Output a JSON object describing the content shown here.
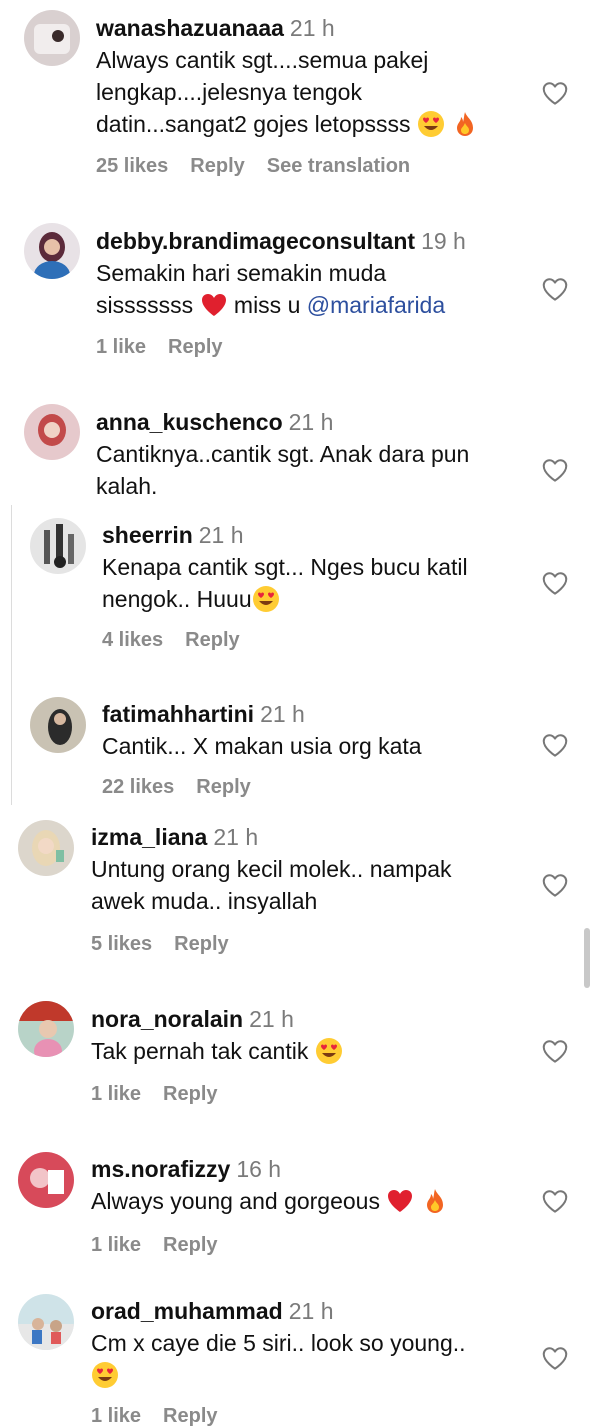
{
  "comments": [
    {
      "username": "wanashazuanaaa",
      "time": "21 h",
      "lines": [
        "Always cantik sgt....semua pakej",
        "lengkap....jelesnya tengok",
        "datin...sangat2 gojes letopssss"
      ],
      "line_emojis": [
        [],
        [],
        [
          "heart-eyes",
          "fire"
        ]
      ],
      "likes": "25 likes",
      "reply": "Reply",
      "translation": "See translation"
    },
    {
      "username": "debby.brandimageconsultant",
      "time": "19 h",
      "lines": [
        "Semakin hari semakin muda",
        "sisssssss"
      ],
      "after_emoji": "miss u",
      "mention": "@mariafarida",
      "likes": "1 like",
      "reply": "Reply"
    },
    {
      "username": "anna_kuschenco",
      "time": "21 h",
      "lines": [
        "Cantiknya..cantik sgt. Anak dara pun",
        "kalah."
      ]
    },
    {
      "username": "sheerrin",
      "time": "21 h",
      "lines": [
        "Kenapa cantik sgt... Nges bucu katil",
        "nengok.. Huuu"
      ],
      "likes": "4 likes",
      "reply": "Reply"
    },
    {
      "username": "fatimahhartini",
      "time": "21 h",
      "lines": [
        "Cantik... X makan usia org kata"
      ],
      "likes": "22 likes",
      "reply": "Reply"
    },
    {
      "username": "izma_liana",
      "time": "21 h",
      "lines": [
        "Untung orang kecil molek.. nampak",
        "awek muda.. insyallah"
      ],
      "likes": "5 likes",
      "reply": "Reply"
    },
    {
      "username": "nora_noralain",
      "time": "21 h",
      "lines": [
        "Tak pernah tak cantik"
      ],
      "likes": "1 like",
      "reply": "Reply"
    },
    {
      "username": "ms.norafizzy",
      "time": "16 h",
      "lines": [
        "Always young and gorgeous"
      ],
      "likes": "1 like",
      "reply": "Reply"
    },
    {
      "username": "orad_muhammad",
      "time": "21 h",
      "lines": [
        "Cm x caye die 5 siri.. look so young.."
      ],
      "likes": "1 like",
      "reply": "Reply"
    }
  ],
  "colors": {
    "mention": "#2d4f9e",
    "meta": "#8a8a8a",
    "timestamp": "#7a7a7a"
  },
  "icons": {
    "like": "heart-outline-icon",
    "emoji_love": "heart-eyes-emoji",
    "emoji_fire": "fire-emoji",
    "emoji_heart": "red-heart-emoji"
  }
}
